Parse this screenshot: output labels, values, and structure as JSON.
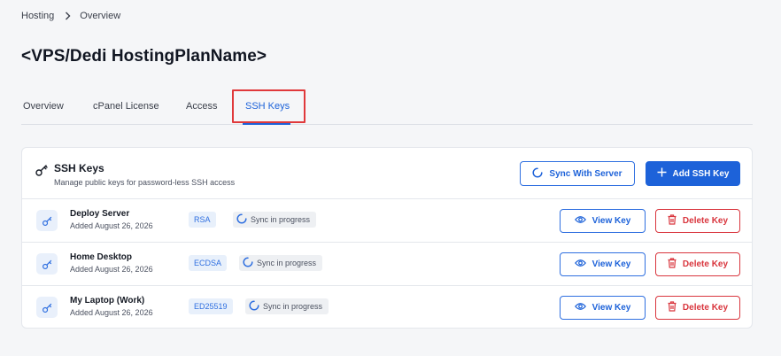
{
  "breadcrumb": {
    "items": [
      "Hosting",
      "Overview"
    ]
  },
  "page": {
    "title": "<VPS/Dedi HostingPlanName>"
  },
  "tabs": [
    {
      "label": "Overview",
      "active": false
    },
    {
      "label": "cPanel License",
      "active": false
    },
    {
      "label": "Access",
      "active": false
    },
    {
      "label": "SSH Keys",
      "active": true
    }
  ],
  "card": {
    "title": "SSH Keys",
    "subtitle": "Manage public keys for password-less SSH access",
    "sync_label": "Sync With Server",
    "add_label": "Add SSH Key",
    "view_label": "View Key",
    "delete_label": "Delete Key",
    "rows": [
      {
        "name": "Deploy Server",
        "date": "Added August 26, 2026",
        "type": "RSA",
        "status": "Sync in progress"
      },
      {
        "name": "Home Desktop",
        "date": "Added August 26, 2026",
        "type": "ECDSA",
        "status": "Sync in progress"
      },
      {
        "name": "My Laptop (Work)",
        "date": "Added August 26, 2026",
        "type": "ED25519",
        "status": "Sync in progress"
      }
    ]
  },
  "colors": {
    "accent": "#1d62d9",
    "danger": "#d9363e",
    "highlight": "#e0393b"
  },
  "icons": [
    "key-icon",
    "sync-icon",
    "plus-icon",
    "eye-icon",
    "trash-icon",
    "spinner-icon",
    "chevron-right-icon"
  ]
}
